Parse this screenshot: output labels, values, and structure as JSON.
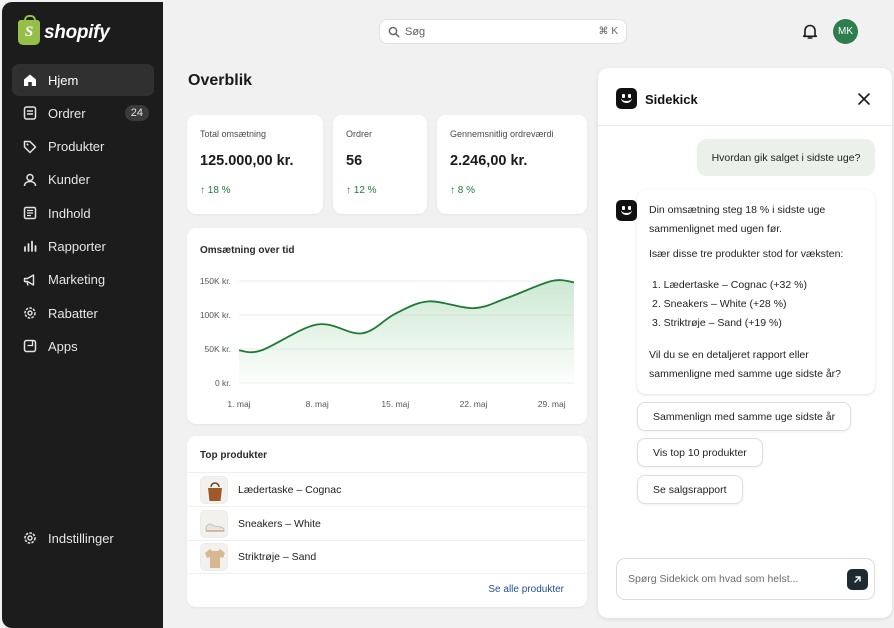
{
  "brand": {
    "logo_text": "shopify",
    "logo_letter": "S",
    "accent": "#95bf47"
  },
  "sidebar": {
    "items": [
      {
        "label": "Hjem",
        "icon": "home-icon"
      },
      {
        "label": "Ordrer",
        "icon": "orders-icon",
        "badge": "24"
      },
      {
        "label": "Produkter",
        "icon": "tag-icon"
      },
      {
        "label": "Kunder",
        "icon": "person-icon"
      },
      {
        "label": "Indhold",
        "icon": "content-icon"
      },
      {
        "label": "Rapporter",
        "icon": "bar-chart-icon"
      },
      {
        "label": "Marketing",
        "icon": "megaphone-icon"
      },
      {
        "label": "Rabatter",
        "icon": "discount-gear-icon"
      },
      {
        "label": "Apps",
        "icon": "apps-icon"
      }
    ],
    "settings_label": "Indstillinger"
  },
  "topbar": {
    "search_placeholder": "Søg",
    "shortcut": "⌘ K",
    "avatar_initials": "MK"
  },
  "main": {
    "title": "Overblik",
    "stats": [
      {
        "label": "Total omsætning",
        "value": "125.000,00 kr.",
        "delta": "↑ 18 %"
      },
      {
        "label": "Ordrer",
        "value": "56",
        "delta": "↑ 12 %"
      },
      {
        "label": "Gennemsnitlig ordreværdi",
        "value": "2.246,00 kr.",
        "delta": "↑ 8 %"
      }
    ],
    "top_products": {
      "title": "Top produkter",
      "items": [
        "Lædertaske – Cognac",
        "Sneakers – White",
        "Striktrøje – Sand"
      ],
      "see_all": "Se alle produkter"
    }
  },
  "chart_data": {
    "type": "area",
    "title": "Omsætning over tid",
    "xlabel": "",
    "ylabel": "",
    "y_ticks": [
      "0 kr.",
      "50K kr.",
      "100K kr.",
      "150K kr."
    ],
    "x_ticks": [
      "1. maj",
      "8. maj",
      "15. maj",
      "22. maj",
      "29. maj"
    ],
    "ylim": [
      0,
      150000
    ],
    "x": [
      1,
      3,
      8,
      12,
      15,
      18,
      22,
      25,
      29,
      31
    ],
    "values": [
      48000,
      48000,
      86000,
      73000,
      102000,
      120000,
      110000,
      125000,
      150000,
      148000
    ],
    "line_color": "#1f7a36",
    "grid": true
  },
  "sidekick": {
    "title": "Sidekick",
    "user_message": "Hvordan gik salget i sidste uge?",
    "reply_intro": "Din omsætning steg 18 % i sidste uge sammenlignet med ugen før.",
    "reply_lead": "Især disse tre produkter stod for væksten:",
    "reply_items": [
      "1.  Lædertaske – Cognac (+32 %)",
      "2.  Sneakers – White (+28 %)",
      "3.  Striktrøje – Sand (+19 %)"
    ],
    "reply_question": "Vil du se en detaljeret rapport eller sammenligne med samme uge sidste år?",
    "chips": [
      "Sammenlign med samme uge sidste år",
      "Vis top 10 produkter",
      "Se salgsrapport"
    ],
    "input_placeholder": "Spørg Sidekick om hvad som helst..."
  }
}
